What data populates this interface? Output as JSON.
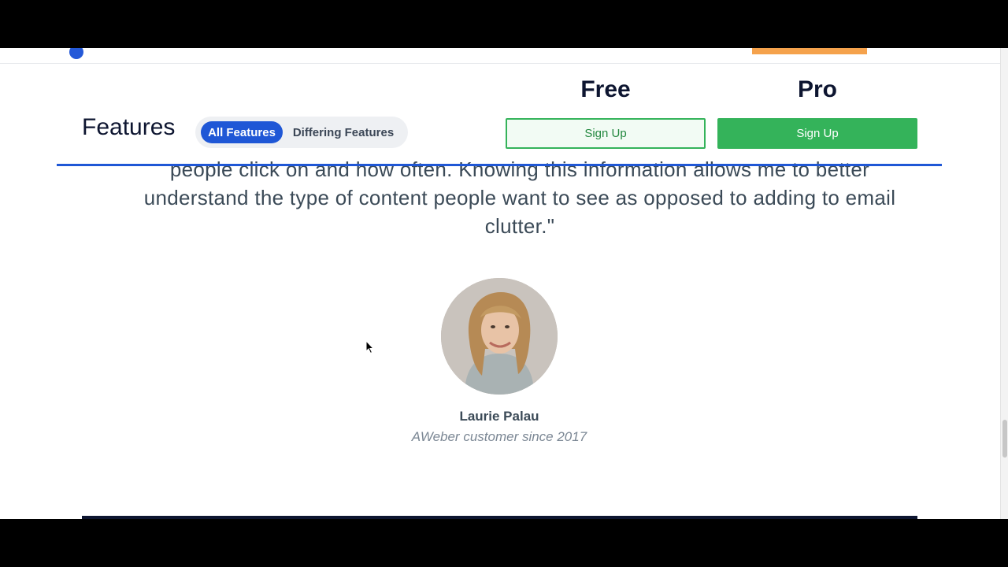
{
  "header": {
    "features_title": "Features",
    "filters": {
      "all_features": "All Features",
      "differing_features": "Differing Features"
    },
    "plans": [
      {
        "name": "Free",
        "cta": "Sign Up"
      },
      {
        "name": "Pro",
        "cta": "Sign Up"
      }
    ]
  },
  "testimonial": {
    "quote": "people click on and how often. Knowing this information allows me to better understand the type of content people want to see as opposed to adding to email clutter.\"",
    "name": "Laurie Palau",
    "meta": "AWeber customer since 2017"
  },
  "colors": {
    "accent_blue": "#1f57d6",
    "cta_green": "#34b35a",
    "cta_orange": "#f5a24c",
    "heading_dark": "#0d1530"
  }
}
